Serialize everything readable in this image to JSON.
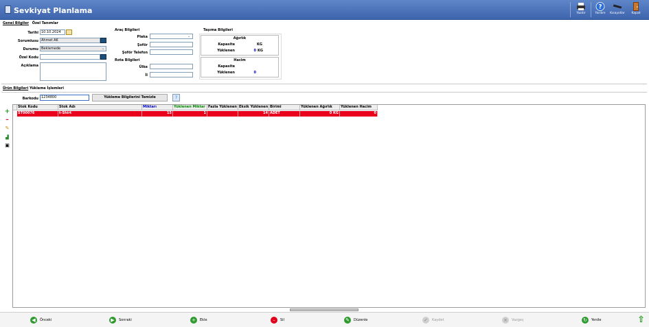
{
  "window": {
    "title": "Sevkiyat Planlama"
  },
  "toolbar": {
    "print": "Yazdır",
    "help": "Yardım",
    "shortcuts": "Kısayollar",
    "close": "Kapat"
  },
  "tabs_top": [
    "Genel Bilgiler",
    "Özel Tanımlar"
  ],
  "general": {
    "date_label": "Tarihi",
    "date_value": "10.10.2024",
    "responsible_label": "Sorumlusu",
    "responsible_value": "Ahmet AK",
    "status_label": "Durumu",
    "status_value": "Beklemede",
    "code_label": "Özel Kodu",
    "code_value": "",
    "note_label": "Açıklama",
    "note_value": ""
  },
  "vehicle": {
    "title": "Araç Bilgileri",
    "plate_label": "Plaka",
    "plate_value": "",
    "driver_label": "Şoför",
    "driver_value": "",
    "phone_label": "Şoför Telefon",
    "phone_value": ""
  },
  "route": {
    "title": "Rota Bilgileri",
    "country_label": "Ülke",
    "country_value": "",
    "city_label": "İl",
    "city_value": ""
  },
  "carry": {
    "title": "Taşıma Bilgileri",
    "weight_title": "Ağırlık",
    "capacity_label": "Kapasite",
    "capacity_unit": "KG",
    "loaded_label": "Yüklenen",
    "loaded_value": "0",
    "loaded_unit": "KG",
    "volume_title": "Hacim",
    "vol_capacity_label": "Kapasite",
    "vol_loaded_label": "Yüklenen",
    "vol_loaded_value": "0"
  },
  "tabs_bottom": [
    "Ürün Bilgileri",
    "Yükleme İşlemleri"
  ],
  "barcode": {
    "label": "Barkodu",
    "value": "1234800",
    "clear_button": "Yükleme Bilgilerini Temizle"
  },
  "table": {
    "columns": [
      "Stok Kodu",
      "Stok Adı",
      "Miktarı",
      "Yüklenen Miktar",
      "Fazla Yüklenen",
      "Eksik Yüklenen",
      "Birimi",
      "Yüklenen Ağırlık",
      "Yüklenen Hacim"
    ],
    "rows": [
      [
        "ST00076",
        "t-Shirt",
        "15",
        "1",
        "",
        "14",
        "ADET",
        "0 KG",
        "0"
      ]
    ]
  },
  "footer": {
    "prev": "Önceki",
    "next": "Sonraki",
    "add": "Ekle",
    "delete": "Sil",
    "edit": "Düzenle",
    "save": "Kaydet",
    "cancel": "Vazgeç",
    "refresh": "Yenile"
  },
  "colors": {
    "titlebar": "#3d64ad",
    "row_highlight": "#e8001c",
    "qty_header": "#0000cc",
    "loaded_header": "#008800"
  }
}
